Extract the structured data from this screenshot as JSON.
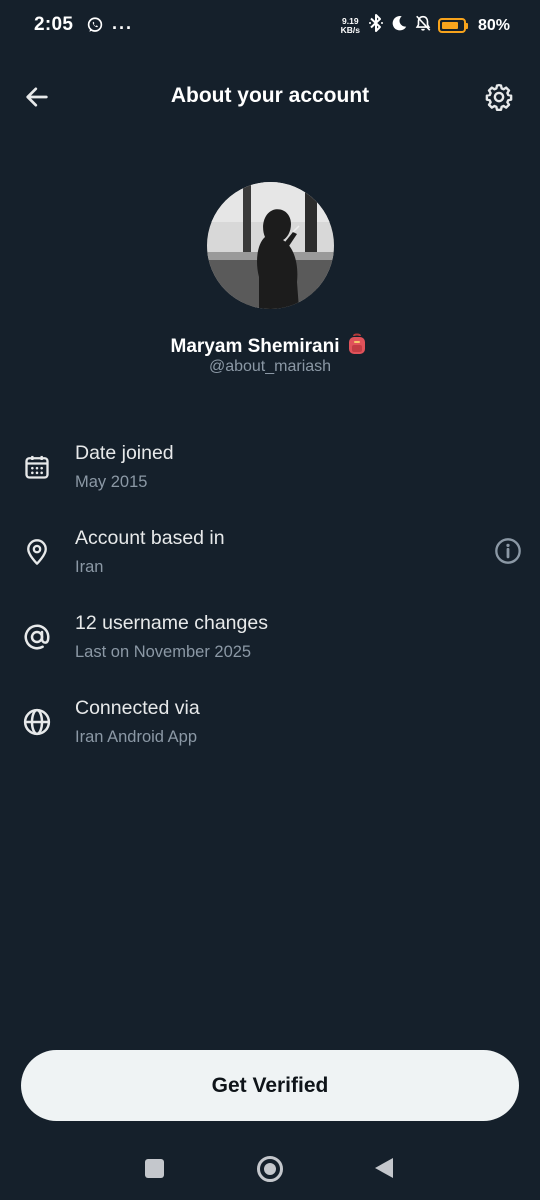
{
  "status_bar": {
    "time": "2:05",
    "more": "···",
    "net_speed_value": "9.19",
    "net_speed_unit": "KB/s",
    "battery_percent": "80%",
    "battery_level": 0.8,
    "battery_color": "#f7a31c",
    "icons": [
      "whatsapp-icon",
      "bluetooth-icon",
      "moon-icon",
      "bell-off-icon",
      "battery-icon"
    ]
  },
  "header": {
    "title": "About your account",
    "back_icon": "arrow-left-icon",
    "settings_icon": "gear-icon"
  },
  "profile": {
    "name": "Maryam Shemirani",
    "emoji": "🎒",
    "handle": "@about_mariash"
  },
  "info_items": [
    {
      "icon": "calendar-icon",
      "title": "Date joined",
      "subtitle": "May 2015"
    },
    {
      "icon": "location-pin-icon",
      "title": "Account based in",
      "subtitle": "Iran",
      "help_icon": "info-circle-icon"
    },
    {
      "icon": "at-sign-icon",
      "title": "12 username changes",
      "subtitle": "Last on November 2025"
    },
    {
      "icon": "globe-icon",
      "title": "Connected via",
      "subtitle": "Iran Android App"
    }
  ],
  "cta": {
    "label": "Get Verified"
  },
  "nav_bar": {
    "icons": [
      "recents-square-icon",
      "home-circle-icon",
      "back-triangle-icon"
    ]
  },
  "colors": {
    "background": "#15202b",
    "primary_text": "#e7e9ea",
    "secondary_text": "#8b98a5",
    "button_bg": "#eff3f4",
    "button_text": "#0f1419"
  }
}
